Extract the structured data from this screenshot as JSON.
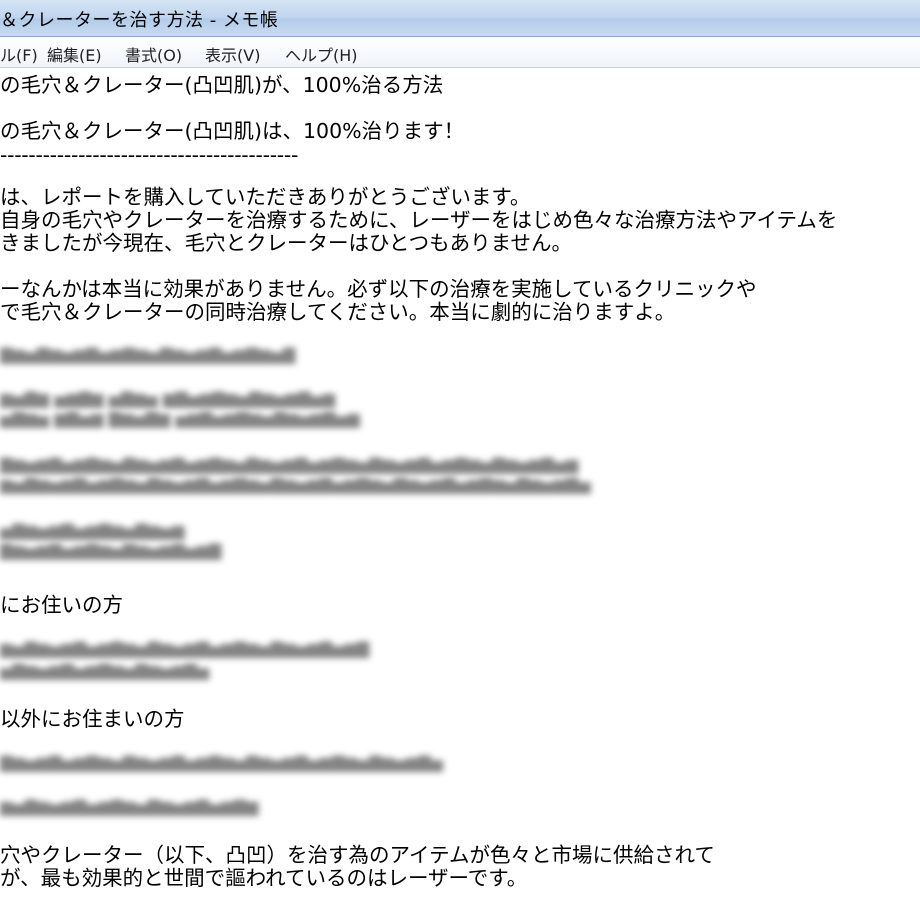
{
  "window": {
    "title": "＆クレーターを治す方法 - メモ帳"
  },
  "menu": [
    {
      "label": "ル(F)"
    },
    {
      "label": "編集(E)"
    },
    {
      "label": "書式(O)"
    },
    {
      "label": "表示(V)"
    },
    {
      "label": "ヘルプ(H)"
    }
  ],
  "document": {
    "lines": [
      "の毛穴＆クレーター(凸凹肌)が、100%治る方法",
      "の毛穴＆クレーター(凸凹肌)は、100%治ります！",
      "------------------------------------------",
      "は、レポートを購入していただきありがとうございます。",
      "自身の毛穴やクレーターを治療するために、レーザーをはじめ色々な治療方法やアイテムを",
      "きましたが今現在、毛穴とクレーターはひとつもありません。",
      "ーなんかは本当に効果がありません。必ず以下の治療を実施しているクリニックや",
      "で毛穴＆クレーターの同時治療してください。本当に劇的に治りますよ。",
      "にお住いの方",
      "以外にお住まいの方",
      "穴やクレーター（以下、凸凹）を治す為のアイテムが色々と市場に供給されて",
      "が、最も効果的と世間で謳われているのはレーザーです。"
    ]
  }
}
